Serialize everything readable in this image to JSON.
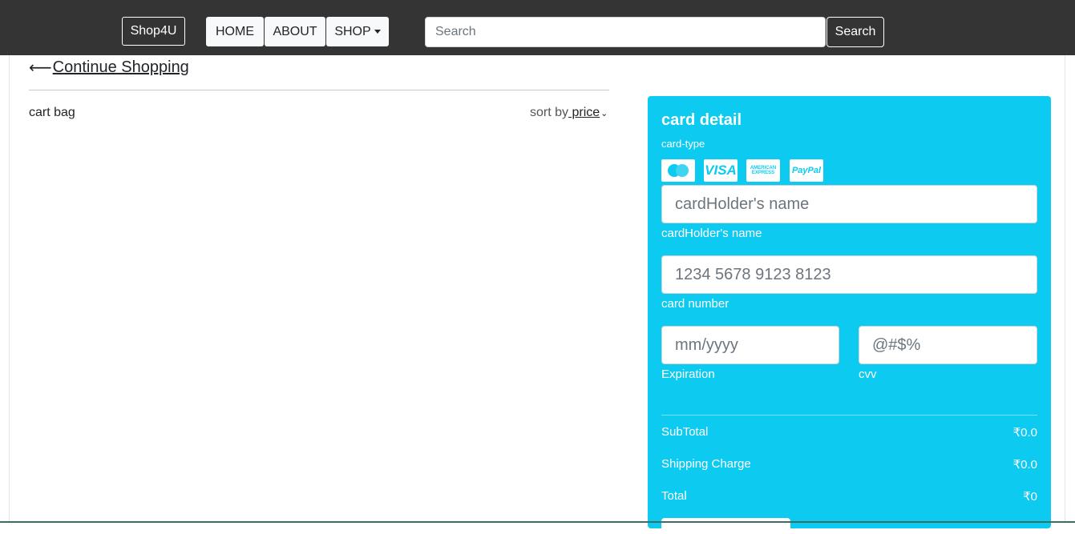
{
  "navbar": {
    "brand": "Shop4U",
    "links": [
      {
        "label": "HOME"
      },
      {
        "label": "ABOUT"
      },
      {
        "label": "SHOP"
      }
    ],
    "search": {
      "placeholder": "Search",
      "button_label": "Search"
    }
  },
  "main": {
    "continue_label": "Continue Shopping",
    "arrow_glyph": "⟵",
    "cart_label": "cart bag",
    "sort_prefix": "sort by",
    "sort_value": " price",
    "sort_chevron": "⌄"
  },
  "card": {
    "title": "card detail",
    "type_label": "card-type",
    "payment_icons": [
      "mastercard-icon",
      "visa-icon",
      "amex-icon",
      "paypal-icon"
    ],
    "visa_text": "VISA",
    "amex_text": "AMERICAN EXPRESS",
    "paypal_text": "PayPal",
    "name_placeholder": "cardHolder's name",
    "name_label": "cardHolder's name",
    "number_placeholder": "1234 5678 9123 8123",
    "number_label": "card number",
    "exp_placeholder": "mm/yyyy",
    "exp_label": "Expiration",
    "cvv_placeholder": "@#$%",
    "cvv_label": "cvv",
    "summary": [
      {
        "label": "SubTotal",
        "value": "₹0.0"
      },
      {
        "label": "Shipping Charge",
        "value": "₹0.0"
      },
      {
        "label": "Total",
        "value": "₹0"
      }
    ]
  },
  "colors": {
    "navbar_bg": "#343434",
    "card_bg": "#0dcaf0"
  }
}
